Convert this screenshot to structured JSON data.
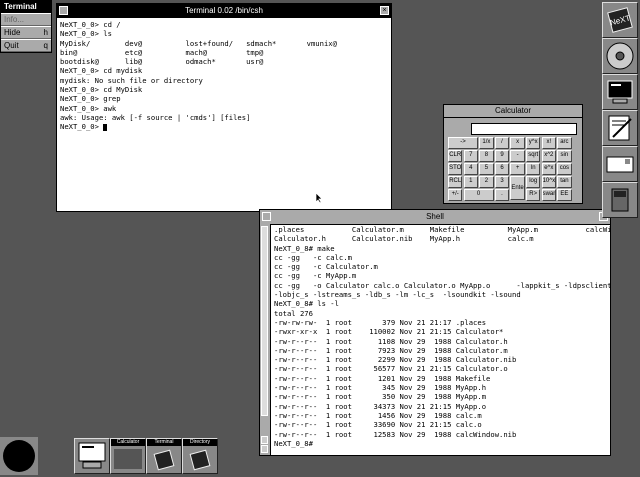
{
  "menu": {
    "title": "Terminal",
    "items": [
      {
        "label": "Info...",
        "key": ""
      },
      {
        "label": "Hide",
        "key": "h"
      },
      {
        "label": "Quit",
        "key": "q"
      }
    ]
  },
  "terminal": {
    "title": "Terminal 0.02 /bin/csh",
    "lines": [
      "NeXT_0_0> cd /",
      "NeXT_0_0> ls",
      "MyDisk/        dev@          lost+found/   sdmach*       vmunix@",
      "bin@           etc@          mach@         tmp@",
      "bootdisk@      lib@          odmach*       usr@",
      "NeXT_0_0> cd mydisk",
      "mydisk: No such file or directory",
      "NeXT_0_0> cd MyDisk",
      "NeXT_0_0> grep",
      "NeXT_0_0> awk",
      "awk: Usage: awk [-f source | 'cmds'] [files]",
      "NeXT_0_0> "
    ]
  },
  "shell": {
    "title": "Shell",
    "lines": [
      ".places           Calculator.m      Makefile          MyApp.m           calcWindow.nib",
      "Calculator.h      Calculator.nib    MyApp.h           calc.m",
      "NeXT_0_8# make",
      "cc -gg   -c calc.m",
      "cc -gg   -c Calculator.m",
      "cc -gg   -c MyApp.m",
      "cc -gg   -o Calculator calc.o Calculator.o MyApp.o      -lappkit_s -ldpsclient_s",
      "-lobjc_s -lstreams_s -ldb_s -lm -lc_s  -lsoundkit -lsound",
      "NeXT_0_8# ls -l",
      "total 276",
      "-rw-rw-rw-  1 root       379 Nov 21 21:17 .places",
      "-rwxr-xr-x  1 root    110002 Nov 21 21:15 Calculator*",
      "-rw-r--r--  1 root      1108 Nov 29  1988 Calculator.h",
      "-rw-r--r--  1 root      7923 Nov 29  1988 Calculator.m",
      "-rw-r--r--  1 root      2299 Nov 29  1988 Calculator.nib",
      "-rw-r--r--  1 root     56577 Nov 21 21:15 Calculator.o",
      "-rw-r--r--  1 root      1201 Nov 29  1988 Makefile",
      "-rw-r--r--  1 root       345 Nov 29  1988 MyApp.h",
      "-rw-r--r--  1 root       350 Nov 29  1988 MyApp.m",
      "-rw-r--r--  1 root     34373 Nov 21 21:15 MyApp.o",
      "-rw-r--r--  1 root      1456 Nov 29  1988 calc.m",
      "-rw-r--r--  1 root     33690 Nov 21 21:15 calc.o",
      "-rw-r--r--  1 root     12583 Nov 29  1988 calcWindow.nib",
      "NeXT_0_8#"
    ]
  },
  "calculator": {
    "title": "Calculator",
    "display": "",
    "keys": [
      [
        "->",
        "1/x",
        "/",
        "x",
        "y^x",
        "x!",
        "arc"
      ],
      [
        "CLR",
        "7",
        "8",
        "9",
        "-",
        "sqrt",
        "x^2",
        "sin"
      ],
      [
        "STO",
        "4",
        "5",
        "6",
        "+",
        "ln",
        "e^x",
        "cos"
      ],
      [
        "RCL",
        "1",
        "2",
        "3",
        "Enter",
        "log",
        "10^x",
        "tan"
      ],
      [
        "+/-",
        "0",
        ".",
        "",
        "R>",
        "swan",
        "EE"
      ]
    ]
  },
  "dock": [
    "NeXT logo",
    "optical disk",
    "terminal",
    "edit",
    "mail",
    "recycler"
  ],
  "miniwindows": [
    "Calculator",
    "Terminal",
    "Directory"
  ],
  "colors": {
    "desktop": "#555555",
    "titlebar": "#000000",
    "panel": "#aaaaaa"
  }
}
